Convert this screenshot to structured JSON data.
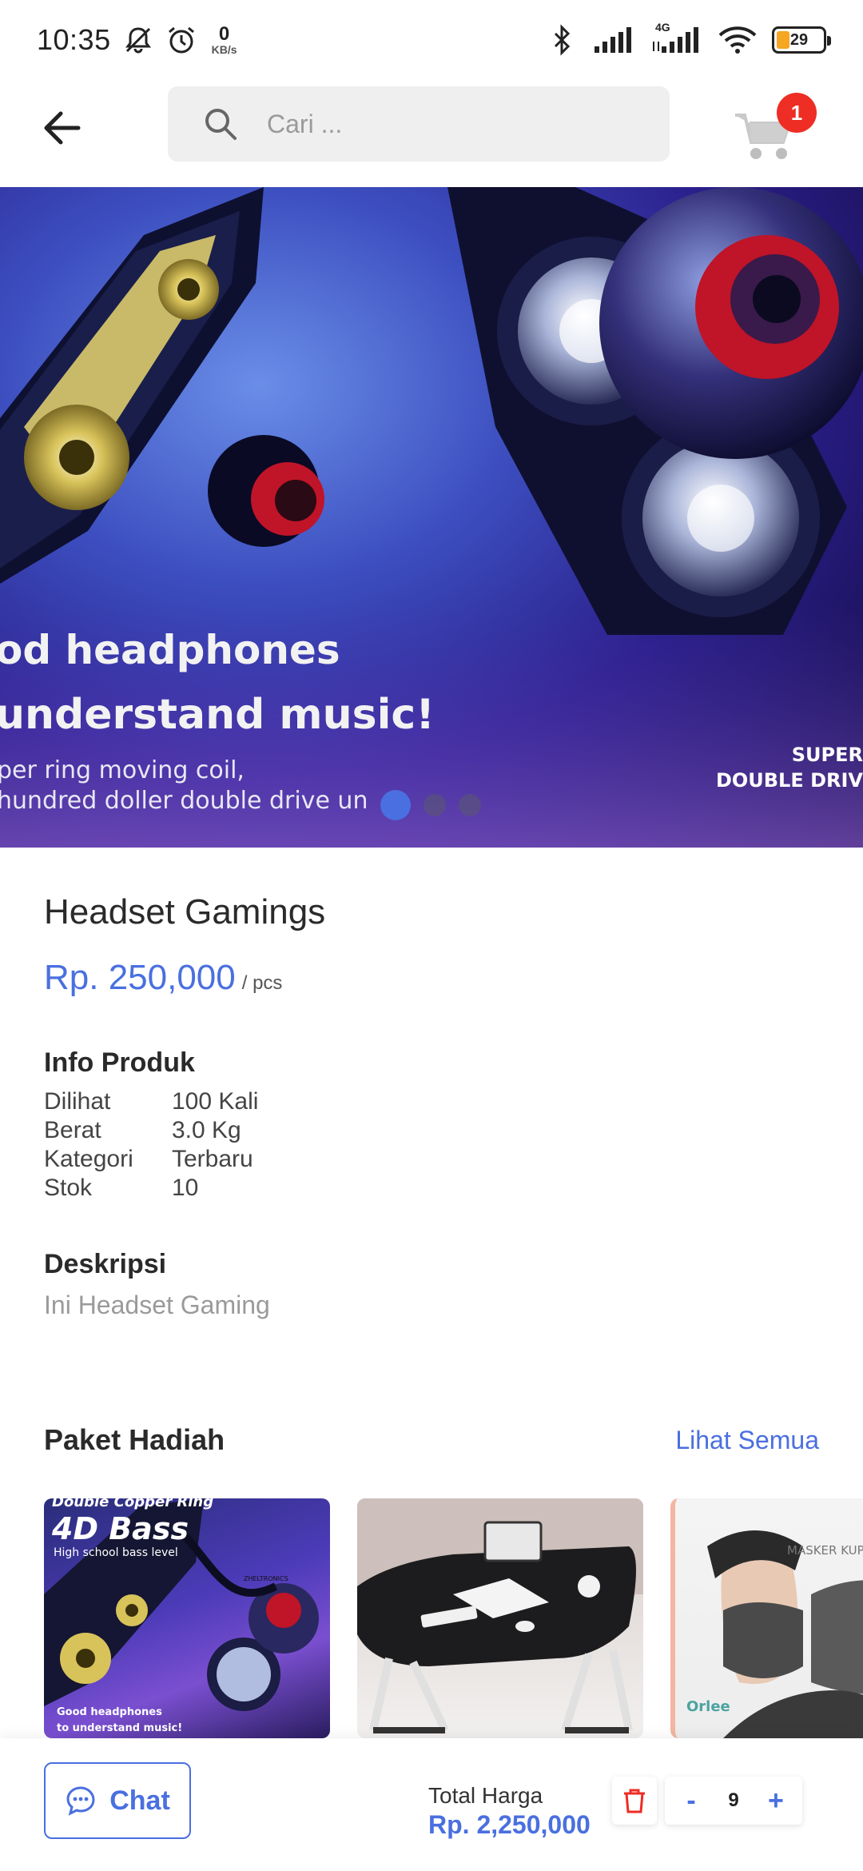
{
  "status_bar": {
    "time": "10:35",
    "net_speed_value": "0",
    "net_speed_unit": "KB/s",
    "network_type": "4G",
    "battery": "29"
  },
  "header": {
    "search_placeholder": "Cari ...",
    "cart_count": "1"
  },
  "banner": {
    "line1": "od headphones",
    "line2": "understand music!",
    "line3": "per ring moving coil,",
    "line4": "hundred doller double drive un",
    "right_line1": "SUPER",
    "right_line2": "DOUBLE DRIV",
    "slides": 3,
    "active_slide": 1
  },
  "product": {
    "name": "Headset Gamings",
    "price": "Rp. 250,000",
    "unit": "/ pcs"
  },
  "info": {
    "title": "Info Produk",
    "rows": [
      {
        "label": "Dilihat",
        "value": "100 Kali"
      },
      {
        "label": "Berat",
        "value": "3.0 Kg"
      },
      {
        "label": "Kategori",
        "value": "Terbaru"
      },
      {
        "label": "Stok",
        "value": "10"
      }
    ]
  },
  "description": {
    "title": "Deskripsi",
    "text": "Ini Headset Gaming"
  },
  "paket": {
    "title": "Paket Hadiah",
    "see_all": "Lihat Semua",
    "items": [
      {
        "top_text": "Double Copper Ring",
        "big_text": "4D Bass",
        "sub_text": "High school bass level",
        "brand": "ZHELTRONICS",
        "bottom1": "Good headphones",
        "bottom2": "to understand music!"
      },
      {},
      {
        "label1": "MASKER KUPIN",
        "label2": "Orlee"
      }
    ]
  },
  "bottom_bar": {
    "chat_label": "Chat",
    "total_label": "Total Harga",
    "total_value": "Rp. 2,250,000",
    "minus": "-",
    "quantity": "9",
    "plus": "+"
  },
  "colors": {
    "accent": "#4a6fe0",
    "badge": "#ee2d24",
    "trash": "#ee2d24"
  }
}
